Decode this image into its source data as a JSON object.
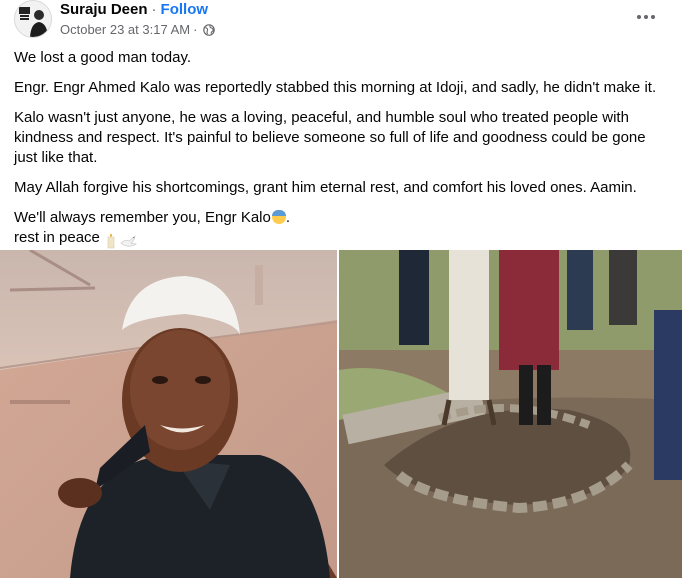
{
  "post": {
    "author": "Suraju Deen",
    "separator": "·",
    "follow_label": "Follow",
    "timestamp": "October 23 at 3:17 AM",
    "meta_separator": "·",
    "privacy_icon": "globe-icon",
    "more_icon": "more-options-icon",
    "paragraphs": {
      "p1": "We lost a good man today.",
      "p2": "Engr. Engr Ahmed Kalo was reportedly stabbed this morning at Idoji, and sadly, he didn't make it.",
      "p3": "Kalo wasn't just anyone, he was a loving, peaceful, and humble soul who treated people with kindness and respect. It's painful to believe someone so full of life and goodness could be gone just like that.",
      "p4": "May Allah forgive his shortcomings, grant him eternal rest, and comfort his loved ones. Aamin.",
      "p5": "We'll always remember you, Engr Kalo",
      "p5_end": ".",
      "p6": "rest in peace"
    },
    "emojis": [
      "anxious-face-with-sweat-emoji",
      "candle-emoji",
      "dove-emoji"
    ]
  },
  "colors": {
    "link": "#1877f2",
    "secondary_text": "#65676b",
    "primary_text": "#050505"
  },
  "photos": [
    "portrait-photo",
    "grave-photo"
  ]
}
